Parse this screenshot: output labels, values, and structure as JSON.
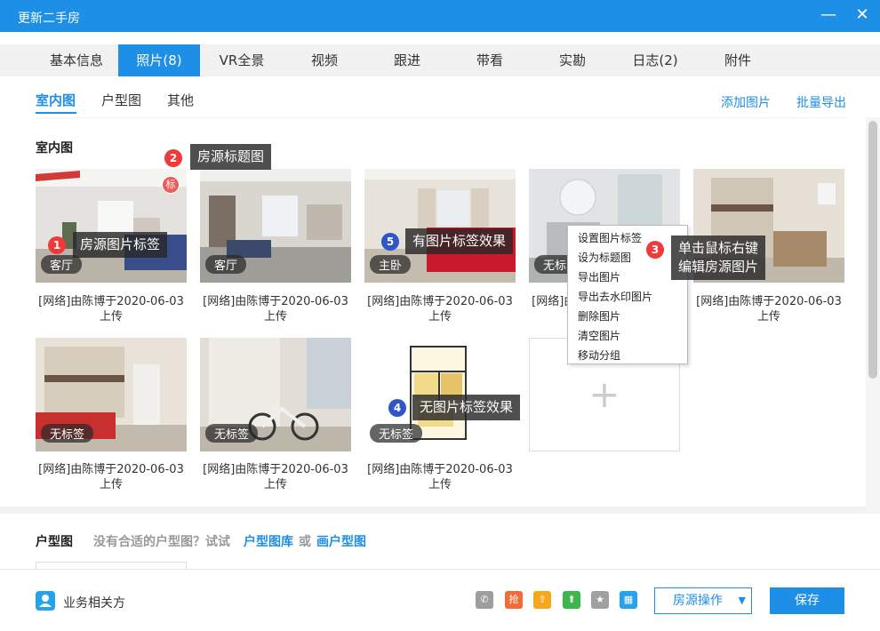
{
  "window": {
    "title": "更新二手房",
    "min": "—",
    "close": "✕"
  },
  "tabs": [
    "基本信息",
    "照片(8)",
    "VR全景",
    "视频",
    "跟进",
    "带看",
    "实勘",
    "日志(2)",
    "附件"
  ],
  "subtabs": [
    "室内图",
    "户型图",
    "其他"
  ],
  "actions": {
    "add": "添加图片",
    "export": "批量导出"
  },
  "section_indoor": "室内图",
  "title_badge": "标",
  "photos": [
    {
      "tag": "客厅",
      "caption": "[网络]由陈博于2020-06-03上传"
    },
    {
      "tag": "客厅",
      "caption": "[网络]由陈博于2020-06-03上传"
    },
    {
      "tag": "主卧",
      "caption": "[网络]由陈博于2020-06-03上传"
    },
    {
      "tag": "无标",
      "caption": "[网络]由陈博于2020-06-03上传"
    },
    {
      "tag": "",
      "caption": "[网络]由陈博于2020-06-03上传"
    },
    {
      "tag": "无标签",
      "caption": "[网络]由陈博于2020-06-03上传"
    },
    {
      "tag": "无标签",
      "caption": "[网络]由陈博于2020-06-03上传"
    },
    {
      "tag": "无标签",
      "caption": "[网络]由陈博于2020-06-03上传"
    }
  ],
  "add_plus": "+",
  "context_menu": [
    "设置图片标签",
    "设为标题图",
    "导出图片",
    "导出去水印图片",
    "删除图片",
    "清空图片",
    "移动分组"
  ],
  "callouts": {
    "c1": {
      "num": "1",
      "text": "房源图片标签"
    },
    "c2": {
      "num": "2",
      "text": "房源标题图"
    },
    "c3": {
      "num": "3",
      "line1": "单击鼠标右键",
      "line2": "编辑房源图片"
    },
    "c4": {
      "num": "4",
      "text": "无图片标签效果"
    },
    "c5": {
      "num": "5",
      "text": "有图片标签效果"
    }
  },
  "huxing": {
    "title": "户型图",
    "hint": "没有合适的户型图？试试",
    "link1": "户型图库",
    "or": "或",
    "link2": "画户型图"
  },
  "footer": {
    "related": "业务相关方",
    "icons": [
      {
        "name": "phone-icon",
        "glyph": "✆",
        "color": "#9e9e9e"
      },
      {
        "name": "grab-icon",
        "glyph": "抢",
        "color": "#f06d3a"
      },
      {
        "name": "top-icon",
        "glyph": "⇧",
        "color": "#f4a81c"
      },
      {
        "name": "up-icon",
        "glyph": "⬆",
        "color": "#3cb84a"
      },
      {
        "name": "star-icon",
        "glyph": "★",
        "color": "#a0a0a0"
      },
      {
        "name": "calculator-icon",
        "glyph": "▦",
        "color": "#27a3e8"
      }
    ],
    "ops": "房源操作",
    "save": "保存"
  },
  "colors": {
    "accent": "#1e8fe6"
  }
}
